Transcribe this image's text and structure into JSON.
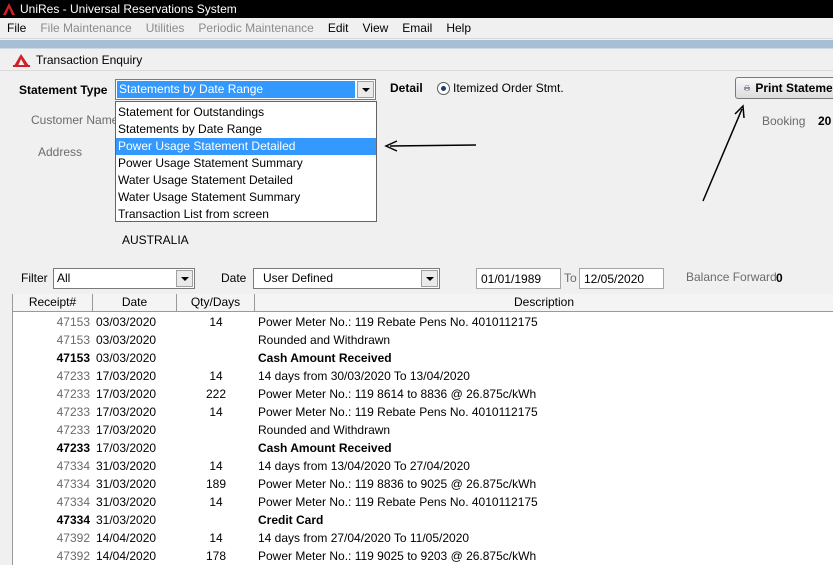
{
  "window": {
    "title": "UniRes - Universal Reservations System",
    "panel_title": "Transaction Enquiry"
  },
  "menu": [
    {
      "label": "File",
      "enabled": true
    },
    {
      "label": "File Maintenance",
      "enabled": false
    },
    {
      "label": "Utilities",
      "enabled": false
    },
    {
      "label": "Periodic Maintenance",
      "enabled": false
    },
    {
      "label": "Edit",
      "enabled": true
    },
    {
      "label": "View",
      "enabled": true
    },
    {
      "label": "Email",
      "enabled": true
    },
    {
      "label": "Help",
      "enabled": true
    }
  ],
  "form": {
    "statement_type_label": "Statement Type",
    "statement_type_value": "Statements by Date Range",
    "statement_type_options": [
      "Statement for Outstandings",
      "Statements by Date Range",
      "Power Usage Statement Detailed",
      "Power Usage Statement Summary",
      "Water Usage Statement Detailed",
      "Water Usage Statement Summary",
      "Transaction List from screen"
    ],
    "highlighted_option_index": 2,
    "detail_label": "Detail",
    "detail_radio_label": "Itemized Order Stmt.",
    "print_button_label": "Print Statement",
    "customer_name_label": "Customer Name",
    "address_label": "Address",
    "address_country": "AUSTRALIA",
    "booking_label": "Booking",
    "booking_value": "20",
    "filter_label": "Filter",
    "filter_value": "All",
    "date_label": "Date",
    "date_value": "User Defined",
    "date_from": "01/01/1989",
    "to_label": "To",
    "date_to": "12/05/2020",
    "balance_forward_label": "Balance Forward",
    "balance_forward_value": "0"
  },
  "grid": {
    "headers": [
      "Receipt#",
      "Date",
      "Qty/Days",
      "Description"
    ],
    "rows": [
      {
        "receipt": "47153",
        "date": "03/03/2020",
        "qty": "14",
        "desc": "Power Meter No.: 119 Rebate Pens No. 4010112175",
        "bold": false
      },
      {
        "receipt": "47153",
        "date": "03/03/2020",
        "qty": "",
        "desc": "Rounded and Withdrawn",
        "bold": false
      },
      {
        "receipt": "47153",
        "date": "03/03/2020",
        "qty": "",
        "desc": "Cash Amount Received",
        "bold": true
      },
      {
        "receipt": "47233",
        "date": "17/03/2020",
        "qty": "14",
        "desc": "14 days from 30/03/2020 To 13/04/2020",
        "bold": false
      },
      {
        "receipt": "47233",
        "date": "17/03/2020",
        "qty": "222",
        "desc": "Power Meter No.: 119 8614 to 8836 @  26.875c/kWh",
        "bold": false
      },
      {
        "receipt": "47233",
        "date": "17/03/2020",
        "qty": "14",
        "desc": "Power Meter No.: 119 Rebate Pens No. 4010112175",
        "bold": false
      },
      {
        "receipt": "47233",
        "date": "17/03/2020",
        "qty": "",
        "desc": "Rounded and Withdrawn",
        "bold": false
      },
      {
        "receipt": "47233",
        "date": "17/03/2020",
        "qty": "",
        "desc": "Cash Amount Received",
        "bold": true
      },
      {
        "receipt": "47334",
        "date": "31/03/2020",
        "qty": "14",
        "desc": "14 days from 13/04/2020 To 27/04/2020",
        "bold": false
      },
      {
        "receipt": "47334",
        "date": "31/03/2020",
        "qty": "189",
        "desc": "Power Meter No.: 119 8836 to 9025 @  26.875c/kWh",
        "bold": false
      },
      {
        "receipt": "47334",
        "date": "31/03/2020",
        "qty": "14",
        "desc": "Power Meter No.: 119 Rebate Pens No. 4010112175",
        "bold": false
      },
      {
        "receipt": "47334",
        "date": "31/03/2020",
        "qty": "",
        "desc": "Credit Card",
        "bold": true
      },
      {
        "receipt": "47392",
        "date": "14/04/2020",
        "qty": "14",
        "desc": "14 days from 27/04/2020 To 11/05/2020",
        "bold": false
      },
      {
        "receipt": "47392",
        "date": "14/04/2020",
        "qty": "178",
        "desc": "Power Meter No.: 119 9025 to 9203 @  26.875c/kWh",
        "bold": false
      }
    ]
  },
  "colors": {
    "selection": "#3399ff",
    "title_bar": "#000000",
    "brand_red": "#d0202a"
  },
  "icons": {
    "app": "unires-logo-icon",
    "print": "printer-icon"
  }
}
